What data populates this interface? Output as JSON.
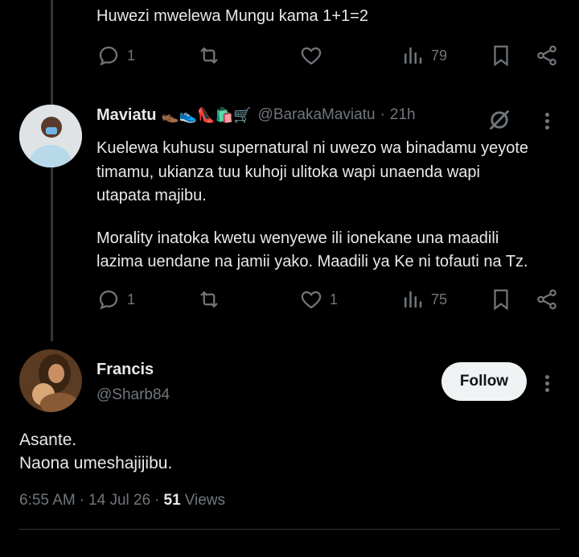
{
  "top_tweet": {
    "text": "Huwezi mwelewa Mungu kama 1+1=2",
    "replies": "1",
    "likes": "",
    "views": "79"
  },
  "reply_tweet": {
    "name": "Maviatu",
    "emoji": "👞👟👠🛍️🛒",
    "handle": "@BarakaMaviatu",
    "separator": "·",
    "time": "21h",
    "paragraph1_line1": "Kuelewa kuhusu supernatural ni uwezo wa binadamu yeyote",
    "paragraph1_line2": "timamu, ukianza tuu kuhoji ulitoka wapi unaenda wapi",
    "paragraph1_line3": "utapata majibu.",
    "paragraph2_line1": "Morality inatoka kwetu wenyewe ili ionekane una maadili",
    "paragraph2_line2": "lazima uendane na jamii yako. Maadili ya Ke ni tofauti na Tz.",
    "replies": "1",
    "likes": "1",
    "views": "75"
  },
  "main_tweet": {
    "name": "Francis",
    "handle": "@Sharb84",
    "follow_label": "Follow",
    "line1": "Asante.",
    "line2": "Naona umeshajijibu.",
    "time": "6:55 AM",
    "date": "14 Jul 26",
    "views_count": "51",
    "views_label": "Views",
    "separator": "·"
  },
  "colors": {
    "background": "#000000",
    "text": "#e7e9ea",
    "muted": "#71767b",
    "divider": "#2f3336",
    "follow_bg": "#eff3f4"
  }
}
